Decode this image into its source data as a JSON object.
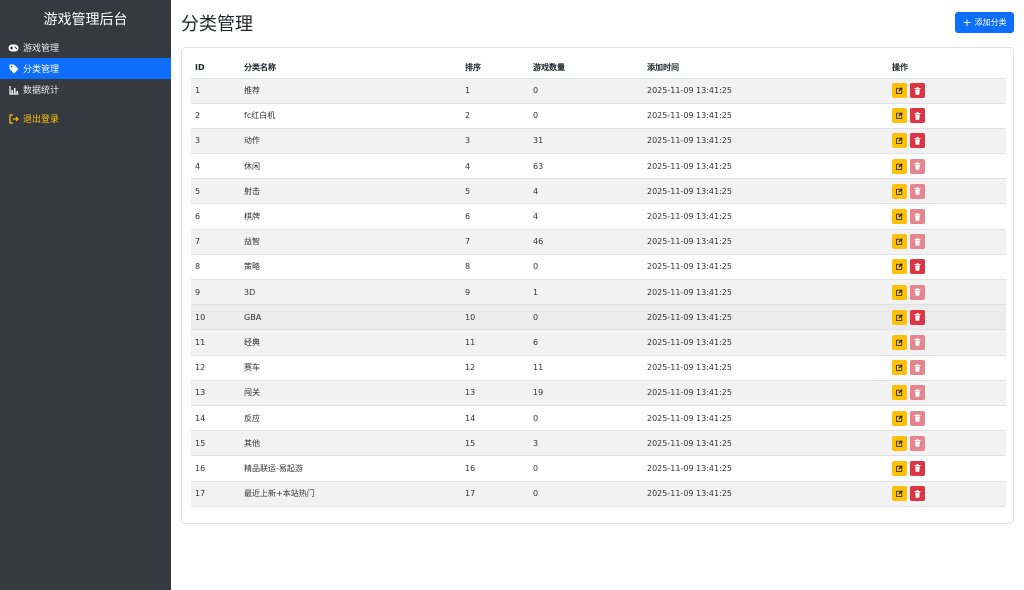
{
  "sidebar": {
    "title": "游戏管理后台",
    "items": [
      {
        "label": "游戏管理",
        "icon": "gamepad-icon"
      },
      {
        "label": "分类管理",
        "icon": "tag-icon",
        "active": true
      },
      {
        "label": "数据统计",
        "icon": "bar-chart-icon"
      }
    ],
    "logout": {
      "label": "退出登录",
      "icon": "logout-icon"
    }
  },
  "main": {
    "title": "分类管理",
    "add_button": "添加分类"
  },
  "table": {
    "headers": [
      "ID",
      "分类名称",
      "排序",
      "游戏数量",
      "添加时间",
      "操作"
    ],
    "rows": [
      {
        "id": "1",
        "name": "推荐",
        "sort": "1",
        "count": "0",
        "time": "2025-11-09 13:41:25"
      },
      {
        "id": "2",
        "name": "fc红白机",
        "sort": "2",
        "count": "0",
        "time": "2025-11-09 13:41:25"
      },
      {
        "id": "3",
        "name": "动作",
        "sort": "3",
        "count": "31",
        "time": "2025-11-09 13:41:25"
      },
      {
        "id": "4",
        "name": "休闲",
        "sort": "4",
        "count": "63",
        "time": "2025-11-09 13:41:25"
      },
      {
        "id": "5",
        "name": "射击",
        "sort": "5",
        "count": "4",
        "time": "2025-11-09 13:41:25"
      },
      {
        "id": "6",
        "name": "棋牌",
        "sort": "6",
        "count": "4",
        "time": "2025-11-09 13:41:25"
      },
      {
        "id": "7",
        "name": "益智",
        "sort": "7",
        "count": "46",
        "time": "2025-11-09 13:41:25"
      },
      {
        "id": "8",
        "name": "策略",
        "sort": "8",
        "count": "0",
        "time": "2025-11-09 13:41:25"
      },
      {
        "id": "9",
        "name": "3D",
        "sort": "9",
        "count": "1",
        "time": "2025-11-09 13:41:25"
      },
      {
        "id": "10",
        "name": "GBA",
        "sort": "10",
        "count": "0",
        "time": "2025-11-09 13:41:25"
      },
      {
        "id": "11",
        "name": "经典",
        "sort": "11",
        "count": "6",
        "time": "2025-11-09 13:41:25"
      },
      {
        "id": "12",
        "name": "赛车",
        "sort": "12",
        "count": "11",
        "time": "2025-11-09 13:41:25"
      },
      {
        "id": "13",
        "name": "闯关",
        "sort": "13",
        "count": "19",
        "time": "2025-11-09 13:41:25"
      },
      {
        "id": "14",
        "name": "反应",
        "sort": "14",
        "count": "0",
        "time": "2025-11-09 13:41:25"
      },
      {
        "id": "15",
        "name": "其他",
        "sort": "15",
        "count": "3",
        "time": "2025-11-09 13:41:25"
      },
      {
        "id": "16",
        "name": "精品联运-易起游",
        "sort": "16",
        "count": "0",
        "time": "2025-11-09 13:41:25"
      },
      {
        "id": "17",
        "name": "最近上新+本站热门",
        "sort": "17",
        "count": "0",
        "time": "2025-11-09 13:41:25"
      }
    ]
  },
  "colors": {
    "sidebar_bg": "#343a40",
    "accent": "#0d6efd",
    "edit": "#ffc107",
    "delete": "#dc3545",
    "delete_disabled": "#e4858f",
    "logout": "#ffc107"
  }
}
